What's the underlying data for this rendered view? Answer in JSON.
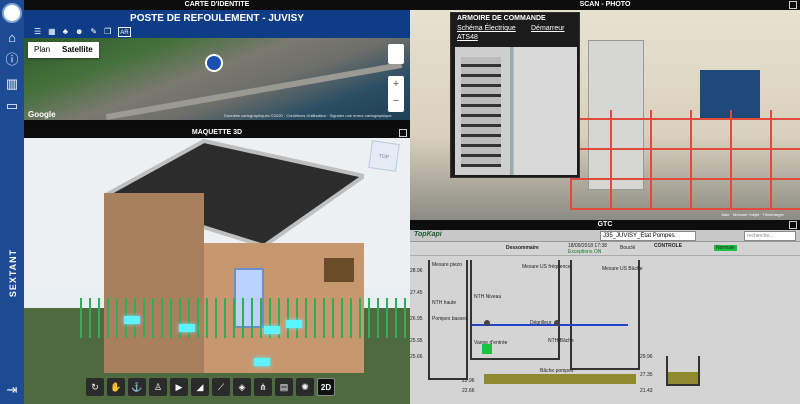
{
  "sidebar": {
    "nav": [
      "home-icon",
      "info-icon",
      "assets-icon",
      "folder-icon"
    ],
    "brand": "SEXTANT",
    "logout_icon": "logout-icon"
  },
  "identity": {
    "section_title": "CARTE D'IDENTITE",
    "page_title": "POSTE DE REFOULEMENT - JUVISY",
    "tools": [
      "layers-icon",
      "map-icon",
      "tree-icon",
      "users-icon",
      "wrench-icon",
      "3d-icon",
      "ar-icon"
    ],
    "tool_ar_label": "AR",
    "map": {
      "type_plan": "Plan",
      "type_satellite": "Satellite",
      "google": "Google",
      "credits": "Données cartographiques ©2020 · Conditions d'utilisation · Signaler une erreur cartographique",
      "zoom_in": "+",
      "zoom_out": "−"
    }
  },
  "model3d": {
    "section_title": "MAQUETTE 3D",
    "navcube_label": "TOP",
    "toolbar": [
      {
        "icon": "orbit-icon"
      },
      {
        "icon": "pan-hand-icon"
      },
      {
        "icon": "anchor-icon"
      },
      {
        "icon": "person-icon"
      },
      {
        "icon": "camera-icon"
      },
      {
        "icon": "section-icon"
      },
      {
        "icon": "measure-icon"
      },
      {
        "icon": "cube-icon"
      },
      {
        "icon": "structure-icon"
      },
      {
        "icon": "properties-icon"
      },
      {
        "icon": "settings-icon"
      },
      {
        "label": "2D"
      }
    ]
  },
  "scan": {
    "section_title": "SCAN - PHOTO",
    "popup_title": "ARMOIRE DE COMMANDE",
    "popup_link_schema": "Schéma Électrique",
    "popup_link_starter": "Démarreur",
    "popup_link_ats": "ATS48",
    "caption": "Aide · Mesurer l'objet · Télécharger"
  },
  "gtc": {
    "section_title": "GTC",
    "brand": "TopKapi",
    "station_select": "J35_JUVISY_Etat Pompes",
    "search_placeholder": "recherche...",
    "status_label": "Dessommaire",
    "date": "18/09/2018 17:38",
    "mode_label": "Bouclé",
    "controls_label": "CONTROLE",
    "status_ok": "Exceptions ON",
    "btn_normal": "Normale",
    "levels": [
      "28.96",
      "27.45",
      "26.95",
      "25.95",
      "25.66",
      "22.96",
      "22.66",
      "21.43",
      "29.96",
      "27.35"
    ],
    "labels": [
      "Mesure US fréquence",
      "NTH haute",
      "NTH Niveau",
      "Pompes basses",
      "Mesure piezo",
      "Vanne d'entrée",
      "Dégrilleur",
      "NTH Bâche",
      "Bâche pompes",
      "Mesure US Bâche"
    ]
  }
}
